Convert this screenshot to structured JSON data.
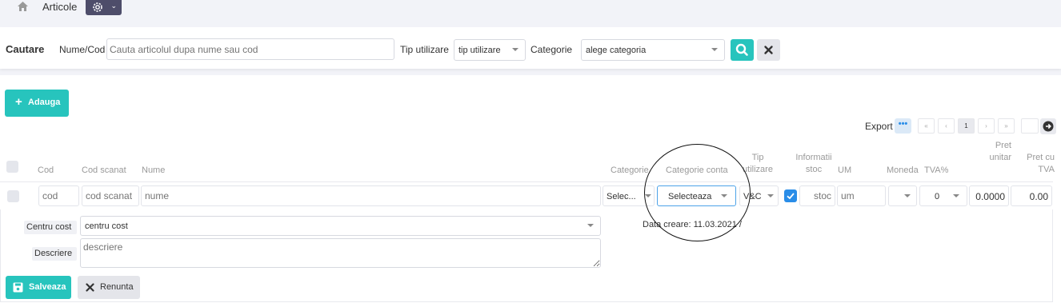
{
  "header": {
    "title": "Articole",
    "home_icon": "home-icon",
    "settings_icon": "gear-icon"
  },
  "search": {
    "title": "Cautare",
    "name_label": "Nume/Cod",
    "name_placeholder": "Cauta articolul dupa nume sau cod",
    "type_label": "Tip utilizare",
    "type_value": "tip utilizare",
    "category_label": "Categorie",
    "category_value": "alege categoria",
    "search_icon": "search-icon",
    "clear_icon": "close-icon"
  },
  "toolbar": {
    "add_label": "Adauga",
    "export_label": "Export",
    "pagination": [
      "«",
      "‹",
      "1",
      "›",
      "»"
    ],
    "current_page": "1"
  },
  "table": {
    "columns": {
      "cod": "Cod",
      "cod_scanat": "Cod scanat",
      "nume": "Nume",
      "categorie": "Categorie",
      "categorie_conta": "Categorie conta",
      "tip_utilizare_1": "Tip",
      "tip_utilizare_2": "utilizare",
      "informatii_1": "Informatii",
      "informatii_2": "stoc",
      "um": "UM",
      "moneda": "Moneda",
      "tva": "TVA%",
      "pret_unitar_1": "Pret",
      "pret_unitar_2": "unitar",
      "pret_tva_1": "Pret cu",
      "pret_tva_2": "TVA"
    },
    "new_row": {
      "cod_placeholder": "cod",
      "cod_scanat_placeholder": "cod scanat",
      "nume_placeholder": "nume",
      "categorie_value": "Selec...",
      "categorie_conta_value": "Selecteaza",
      "tip_utilizare_value": "V&C",
      "stoc_placeholder": "stoc",
      "um_placeholder": "um",
      "moneda_value": "",
      "tva_value": "0",
      "pret_unitar_value": "0.0000",
      "pret_tva_value": "0.00"
    }
  },
  "details": {
    "centru_cost_label": "Centru cost",
    "centru_cost_value": "centru cost",
    "descriere_label": "Descriere",
    "descriere_placeholder": "descriere",
    "data_creare": "Data creare: 11.03.2021 /",
    "save_label": "Salveaza",
    "cancel_label": "Renunta"
  },
  "colors": {
    "accent": "#27c4bd",
    "dark": "#4e4d6a",
    "checkbox": "#2a8de8"
  }
}
